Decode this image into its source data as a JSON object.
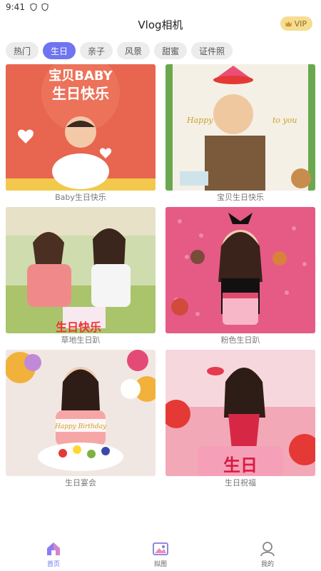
{
  "status": {
    "time": "9:41"
  },
  "header": {
    "title": "Vlog相机",
    "vip_label": "VIP"
  },
  "tabs": [
    {
      "label": "热门",
      "active": false
    },
    {
      "label": "生日",
      "active": true
    },
    {
      "label": "亲子",
      "active": false
    },
    {
      "label": "风景",
      "active": false
    },
    {
      "label": "甜蜜",
      "active": false
    },
    {
      "label": "证件照",
      "active": false
    }
  ],
  "templates": [
    {
      "label": "Baby生日快乐",
      "overlay_text": "宝贝BABY生日快乐",
      "bg": "#e8654f"
    },
    {
      "label": "宝贝生日快乐",
      "overlay_text": "Happy Birthday to you",
      "bg": "#f4f0e6"
    },
    {
      "label": "草地生日趴",
      "overlay_text": "生日快乐",
      "bg": "#c9d7a8"
    },
    {
      "label": "粉色生日趴",
      "overlay_text": "",
      "bg": "#e55b85"
    },
    {
      "label": "生日宴会",
      "overlay_text": "Happy Birthday",
      "bg": "#f1e7e2"
    },
    {
      "label": "生日祝福",
      "overlay_text": "生日",
      "bg": "#f2a8b7"
    }
  ],
  "nav": [
    {
      "label": "首页",
      "icon": "home-icon",
      "active": true
    },
    {
      "label": "拟图",
      "icon": "gallery-icon",
      "active": false
    },
    {
      "label": "我的",
      "icon": "profile-icon",
      "active": false
    }
  ],
  "colors": {
    "accent": "#6f74f0",
    "vip_bg": "#f6dd92",
    "tab_bg": "#ececec"
  }
}
